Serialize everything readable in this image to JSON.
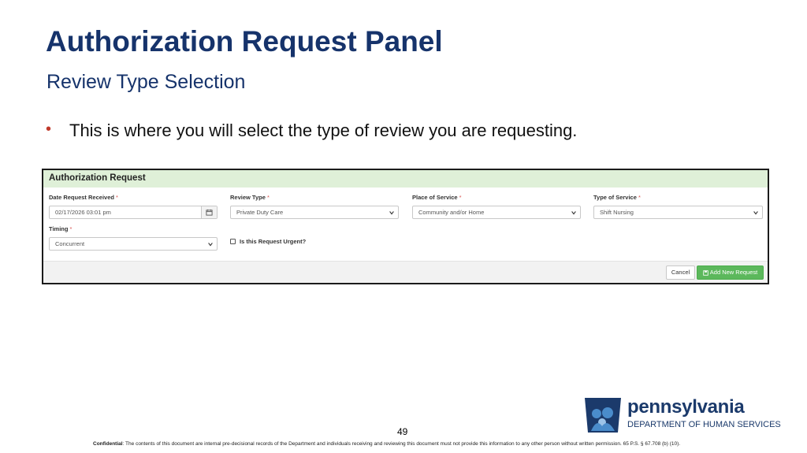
{
  "slide": {
    "title": "Authorization Request Panel",
    "subtitle": "Review Type Selection",
    "bullet": "This is where you will select the type of review you are requesting.",
    "page_number": "49"
  },
  "panel": {
    "header": "Authorization Request",
    "fields": {
      "date_request_received": {
        "label": "Date Request Received",
        "value": "02/17/2026 03:01 pm"
      },
      "review_type": {
        "label": "Review Type",
        "value": "Private Duty Care"
      },
      "place_of_service": {
        "label": "Place of Service",
        "value": "Community and/or Home"
      },
      "type_of_service": {
        "label": "Type of Service",
        "value": "Shift Nursing"
      },
      "timing": {
        "label": "Timing",
        "value": "Concurrent"
      }
    },
    "required_marker": "*",
    "urgent_checkbox": {
      "label": "Is this Request Urgent?",
      "checked": false
    },
    "buttons": {
      "cancel": "Cancel",
      "add": "Add New Request"
    }
  },
  "footer": {
    "confidential_label": "Confidential",
    "confidential_text": ": The contents of this document are internal pre-decisional records of the Department and individuals receiving and reviewing this document must not provide this information to any other person without written permission. 65 P.S. § 67.708 (b) (10)."
  },
  "logo": {
    "wordmark": "pennsylvania",
    "department": "DEPARTMENT OF HUMAN SERVICES"
  },
  "colors": {
    "title": "#16336b",
    "bullet": "#c0392b",
    "panel_header_bg": "#dff0d8",
    "add_button": "#5cb85c",
    "required": "#d9534f",
    "logo_blue": "#1b3a6b",
    "logo_light": "#4a8ccb"
  },
  "icons": {
    "date_button": "calendar-icon",
    "select_arrow": "chevron-down-icon",
    "add_button": "save-icon",
    "logo": "keystone-family-icon"
  }
}
